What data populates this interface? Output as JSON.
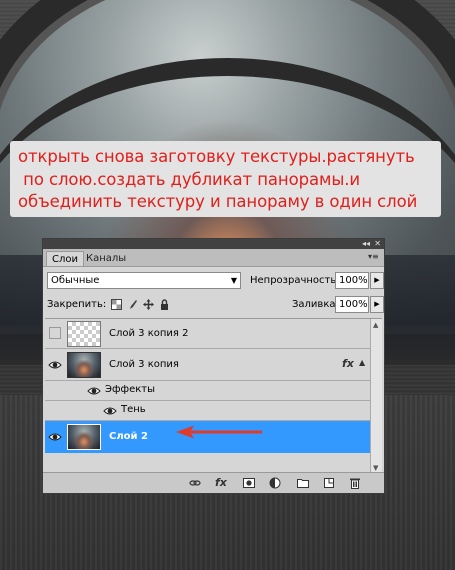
{
  "instruction": {
    "line1": "открыть снова заготовку текстуры.растянуть",
    "line2": " по слою.создать дубликат панорамы.и",
    "line3": "объединить текстуру и панораму в один слой",
    "color": "#e0201c"
  },
  "panel": {
    "tabs": [
      {
        "label": "Слои",
        "active": true
      },
      {
        "label": "Каналы",
        "active": false
      }
    ],
    "blend_mode": "Обычные",
    "opacity_label": "Непрозрачность:",
    "opacity_value": "100%",
    "lock_label": "Закрепить:",
    "fill_label": "Заливка:",
    "fill_value": "100%",
    "layers": [
      {
        "name": "Слой 3 копия 2",
        "visible": false,
        "selected": false,
        "thumb": "transparent"
      },
      {
        "name": "Слой 3 копия",
        "visible": true,
        "selected": false,
        "thumb": "image",
        "fx": "fx"
      },
      {
        "name": "Эффекты",
        "type": "effects-group"
      },
      {
        "name": "Тень",
        "type": "effect"
      },
      {
        "name": "Слой 2",
        "visible": true,
        "selected": true,
        "thumb": "image"
      }
    ],
    "selection_color": "#3399ff",
    "bottom_icons": [
      "link-icon",
      "fx-icon",
      "mask-icon",
      "adjustment-icon",
      "folder-icon",
      "new-layer-icon",
      "trash-icon"
    ],
    "bottom_fx": "fx"
  },
  "annotation": {
    "arrow_color": "#e03a2a"
  }
}
